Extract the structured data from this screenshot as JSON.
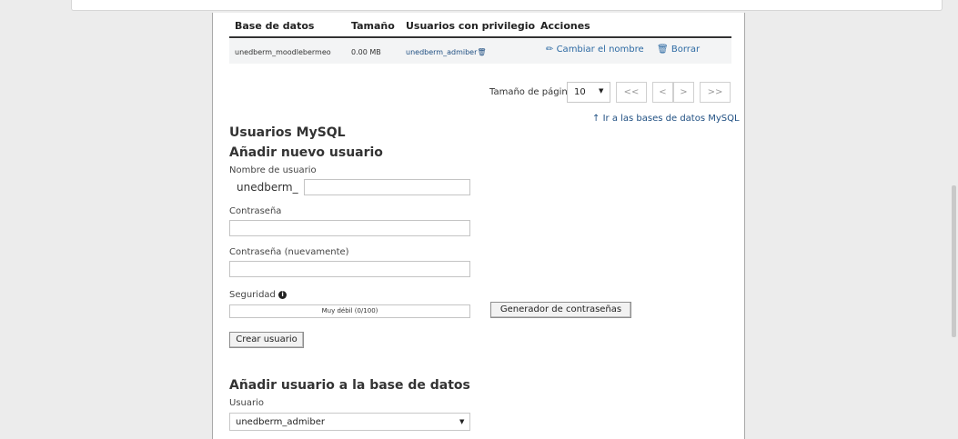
{
  "table": {
    "headers": {
      "database": "Base de datos",
      "size": "Tamaño",
      "users": "Usuarios con privilegio",
      "actions": "Acciones"
    },
    "rows": [
      {
        "database": "unedberm_moodlebermeo",
        "size": "0.00 MB",
        "user": "unedberm_admiber",
        "rename": "Cambiar el nombre",
        "delete": "Borrar"
      }
    ]
  },
  "pagination": {
    "label": "Tamaño de página",
    "page_size": "10",
    "first": "<<",
    "prev": "<",
    "next": ">",
    "last": ">>"
  },
  "back_link": "Ir a las bases de datos MySQL",
  "mysql_users": {
    "title": "Usuarios MySQL",
    "add_user_title": "Añadir nuevo usuario",
    "username_label": "Nombre de usuario",
    "username_prefix": "unedberm_",
    "username_value": "",
    "password_label": "Contraseña",
    "password_value": "",
    "password_again_label": "Contraseña (nuevamente)",
    "password_again_value": "",
    "security_label": "Seguridad",
    "strength_text": "Muy débil (0/100)",
    "strength_value": 0,
    "generator_button": "Generador de contraseñas",
    "create_button": "Crear usuario"
  },
  "add_to_db": {
    "title": "Añadir usuario a la base de datos",
    "user_label": "Usuario",
    "user_selected": "unedberm_admiber"
  },
  "colors": {
    "link": "#2d6aa3",
    "page_bg": "#ececec"
  }
}
